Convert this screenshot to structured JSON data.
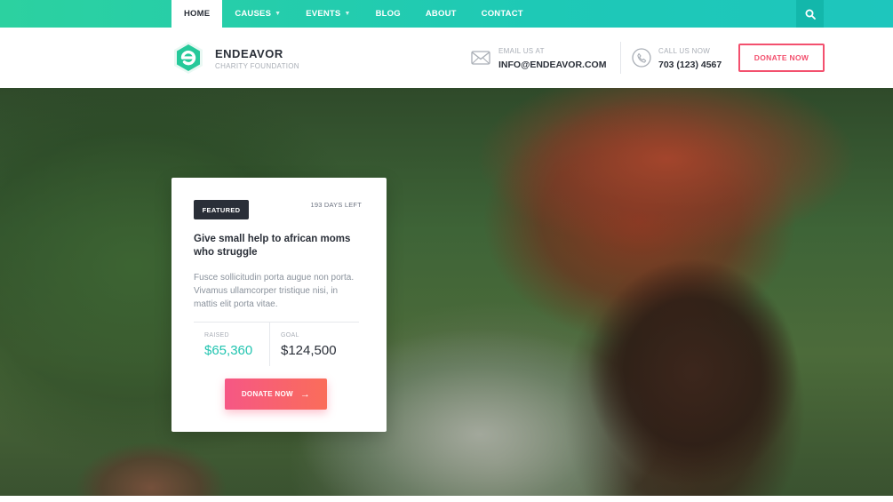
{
  "nav": {
    "items": [
      {
        "label": "HOME",
        "active": true,
        "has_dropdown": false
      },
      {
        "label": "CAUSES",
        "active": false,
        "has_dropdown": true
      },
      {
        "label": "EVENTS",
        "active": false,
        "has_dropdown": true
      },
      {
        "label": "BLOG",
        "active": false,
        "has_dropdown": false
      },
      {
        "label": "ABOUT",
        "active": false,
        "has_dropdown": false
      },
      {
        "label": "CONTACT",
        "active": false,
        "has_dropdown": false
      }
    ],
    "search_icon": "search-icon"
  },
  "brand": {
    "name": "ENDEAVOR",
    "tagline": "CHARITY FOUNDATION",
    "logo_icon": "e-hexagon-logo"
  },
  "contact": {
    "email_label": "EMAIL US AT",
    "email_value": "INFO@ENDEAVOR.COM",
    "phone_label": "CALL US NOW",
    "phone_value": "703 (123) 4567"
  },
  "header": {
    "donate_label": "DONATE NOW"
  },
  "featured": {
    "badge": "FEATURED",
    "days_left": "193 DAYS LEFT",
    "title": "Give small help to african moms who struggle",
    "description": "Fusce sollicitudin porta augue non porta. Vivamus ullamcorper tristique nisi, in mattis elit porta vitae.",
    "raised_label": "RAISED",
    "raised_value": "$65,360",
    "goal_label": "GOAL",
    "goal_value": "$124,500",
    "donate_label": "DONATE NOW"
  },
  "colors": {
    "accent_teal": "#22c4b0",
    "accent_pink": "#f3506e",
    "dark": "#2a2f38"
  }
}
